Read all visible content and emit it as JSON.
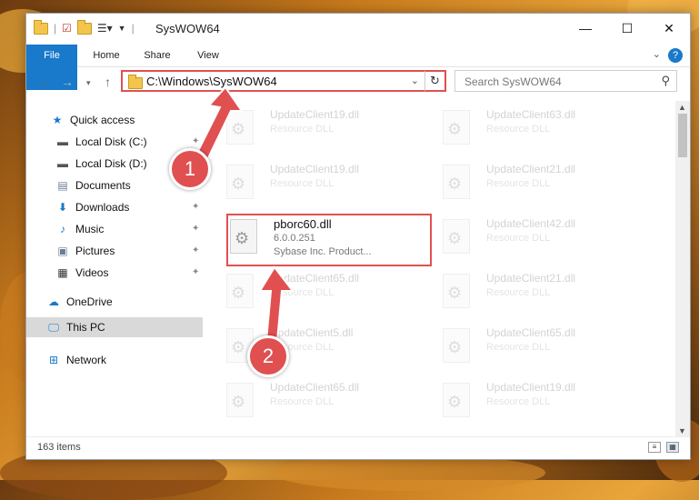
{
  "window": {
    "title": "SysWOW64",
    "controls": {
      "minimize": "—",
      "maximize": "☐",
      "close": "✕"
    }
  },
  "ribbon": {
    "tabs": [
      "File",
      "Home",
      "Share",
      "View"
    ],
    "help": "?"
  },
  "address": {
    "path": "C:\\Windows\\SysWOW64"
  },
  "search": {
    "placeholder": "Search SysWOW64"
  },
  "nav_pane": {
    "items": [
      {
        "label": "Quick access",
        "icon": "star-icon"
      },
      {
        "label": "Local Disk (C:)",
        "icon": "drive-icon"
      },
      {
        "label": "Local Disk (D:)",
        "icon": "drive-icon"
      },
      {
        "label": "Documents",
        "icon": "documents-icon"
      },
      {
        "label": "Downloads",
        "icon": "downloads-icon"
      },
      {
        "label": "Music",
        "icon": "music-icon"
      },
      {
        "label": "Pictures",
        "icon": "pictures-icon"
      },
      {
        "label": "Videos",
        "icon": "videos-icon"
      },
      {
        "label": "OneDrive",
        "icon": "cloud-icon"
      },
      {
        "label": "This PC",
        "icon": "computer-icon"
      },
      {
        "label": "Network",
        "icon": "network-icon"
      }
    ]
  },
  "files": {
    "left": [
      {
        "name": "UpdateClient19.dll",
        "type": "Resource DLL"
      },
      {
        "name": "UpdateClient19.dll",
        "type": "Resource DLL"
      },
      {
        "name": "pborc60.dll",
        "version": "6.0.0.251",
        "company": "Sybase Inc. Product..."
      },
      {
        "name": "UpdateClient65.dll",
        "type": "Resource DLL"
      },
      {
        "name": "UpdateClient5.dll",
        "type": "Resource DLL"
      },
      {
        "name": "UpdateClient65.dll",
        "type": "Resource DLL"
      }
    ],
    "right": [
      {
        "name": "UpdateClient63.dll",
        "type": "Resource DLL"
      },
      {
        "name": "UpdateClient21.dll",
        "type": "Resource DLL"
      },
      {
        "name": "UpdateClient42.dll",
        "type": "Resource DLL"
      },
      {
        "name": "UpdateClient21.dll",
        "type": "Resource DLL"
      },
      {
        "name": "UpdateClient65.dll",
        "type": "Resource DLL"
      },
      {
        "name": "UpdateClient19.dll",
        "type": "Resource DLL"
      }
    ]
  },
  "status": {
    "item_count": "163 items"
  },
  "callouts": [
    "1",
    "2"
  ],
  "colors": {
    "accent": "#1979ca",
    "highlight": "#e05050"
  }
}
